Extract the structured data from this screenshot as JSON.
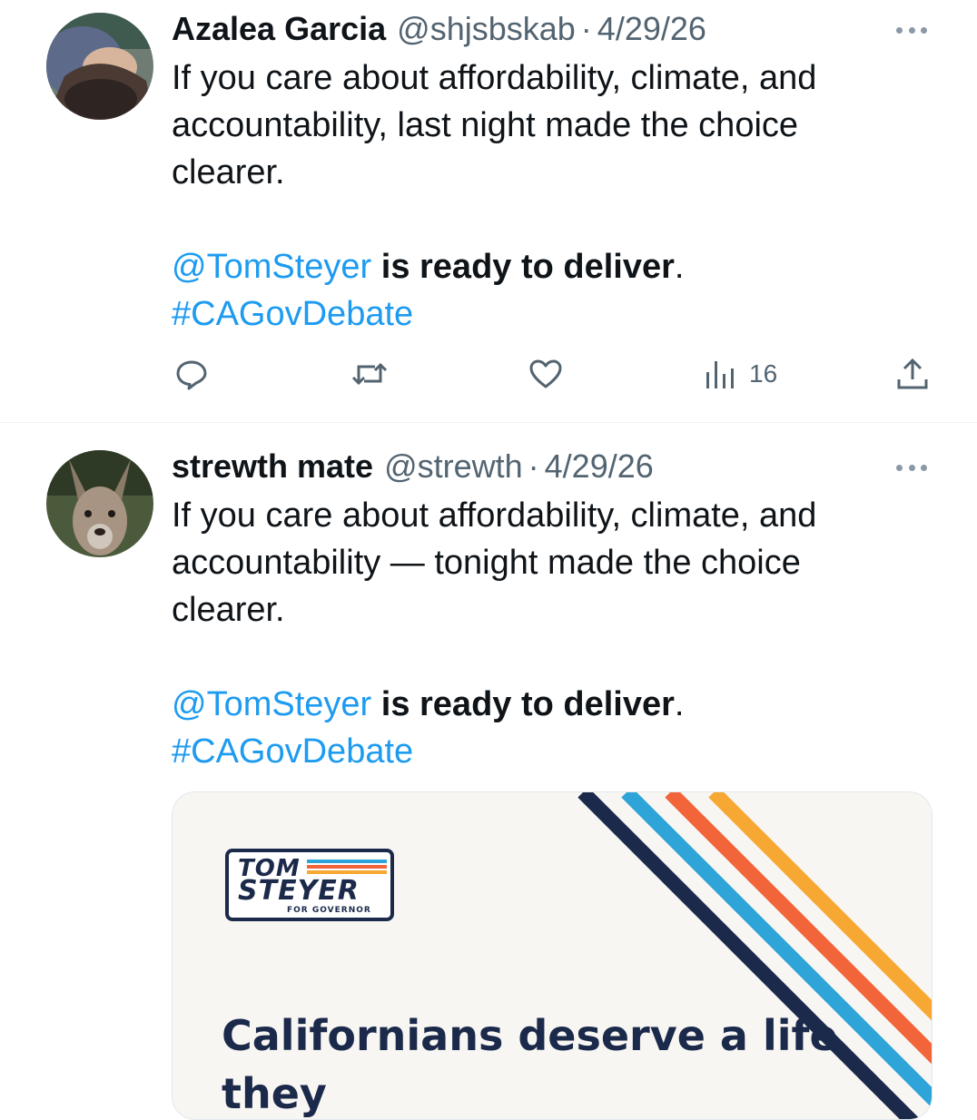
{
  "colors": {
    "accent": "#1d9bf0",
    "text": "#0f1419",
    "muted": "#536471",
    "navy": "#1b2a4a",
    "light_blue": "#2fa4d8",
    "orange": "#f2643a",
    "yellow": "#f7a833"
  },
  "tweets": [
    {
      "name": "Azalea Garcia",
      "handle": "@shjsbskab",
      "separator": "·",
      "date": "4/29/26",
      "text_line1": "If you care about affordability, climate, and",
      "text_line2": "accountability, last night made the choice",
      "text_line3": "clearer.",
      "mention": "@TomSteyer",
      "bold_text": " is ready to deliver",
      "period": ".",
      "hashtag": "#CAGovDebate",
      "actions": {
        "reply_icon": "reply-icon",
        "retweet_icon": "retweet-icon",
        "like_icon": "heart-icon",
        "views_icon": "views-chart-icon",
        "views_count": "16",
        "share_icon": "share-icon"
      }
    },
    {
      "name": "strewth mate",
      "handle": "@strewth",
      "separator": "·",
      "date": "4/29/26",
      "text_line1": "If you care about affordability, climate, and",
      "text_line2": "accountability — tonight made the choice",
      "text_line3": "clearer.",
      "mention": "@TomSteyer",
      "bold_text": " is ready to deliver",
      "period": ".",
      "hashtag": "#CAGovDebate",
      "card": {
        "logo_line1": "TOM",
        "logo_line2": "STEYER",
        "logo_line3": "FOR GOVERNOR",
        "headline": "Californians deserve a life they"
      }
    }
  ]
}
